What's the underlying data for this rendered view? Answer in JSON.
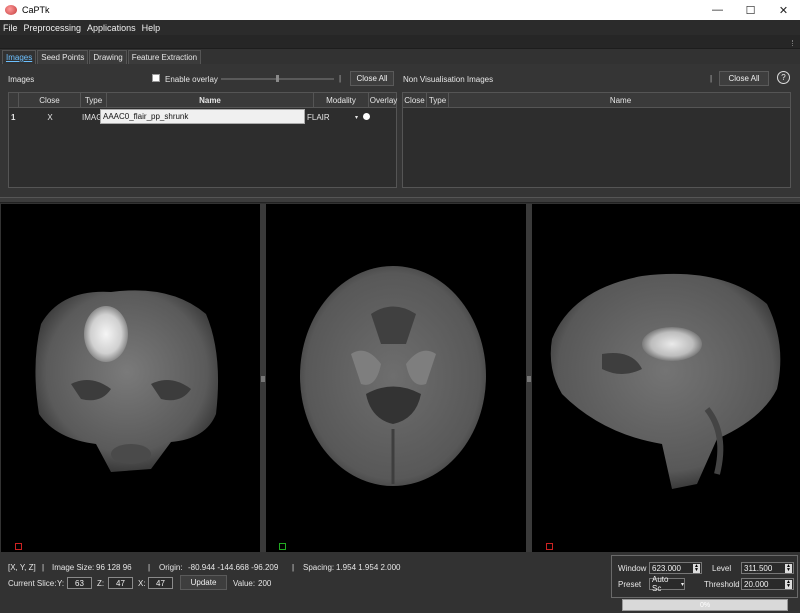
{
  "window": {
    "title": "CaPTk",
    "minimize": "—",
    "maximize": "☐",
    "close": "✕"
  },
  "menu": [
    "File",
    "Preprocessing",
    "Applications",
    "Help"
  ],
  "tabs": [
    "Images",
    "Seed Points",
    "Drawing",
    "Feature Extraction"
  ],
  "images_panel": {
    "heading": "Images",
    "enable_overlay": "Enable overlay",
    "close_all": "Close All",
    "columns": [
      "Close",
      "Type",
      "Name",
      "Modality",
      "Overlay"
    ],
    "row": {
      "index": "1",
      "close": "X",
      "type": "IMAGE",
      "name": "AAAC0_flair_pp_shrunk",
      "modality": "FLAIR"
    },
    "overlay_opacity": 0.5
  },
  "non_vis_panel": {
    "heading": "Non Visualisation Images",
    "close_all": "Close All",
    "help": "?",
    "columns": [
      "Close",
      "Type",
      "Name"
    ]
  },
  "info": {
    "coords_label": "[X, Y, Z]",
    "image_size_label": "Image Size:",
    "image_size": "96  128  96",
    "origin_label": "Origin:",
    "origin": "-80.944  -144.668  -96.209",
    "spacing_label": "Spacing:",
    "spacing": "1.954  1.954  2.000",
    "current_slice_label": "Current Slice:",
    "y_label": "Y:",
    "y_value": "63",
    "z_label": "Z:",
    "z_value": "47",
    "x_label": "X:",
    "x_value": "47",
    "update": "Update",
    "value_label": "Value:",
    "value": "200"
  },
  "window_level": {
    "window_label": "Window",
    "window_value": "623.000",
    "level_label": "Level",
    "level_value": "311.500",
    "preset_label": "Preset",
    "preset_value": "Auto Sc",
    "threshold_label": "Threshold",
    "threshold_value": "20.000"
  },
  "progress": {
    "text": "0%",
    "value": 0
  },
  "colors": {
    "accent": "#6cc0ff",
    "marker_red": "#cc2222",
    "marker_green": "#22aa22"
  }
}
